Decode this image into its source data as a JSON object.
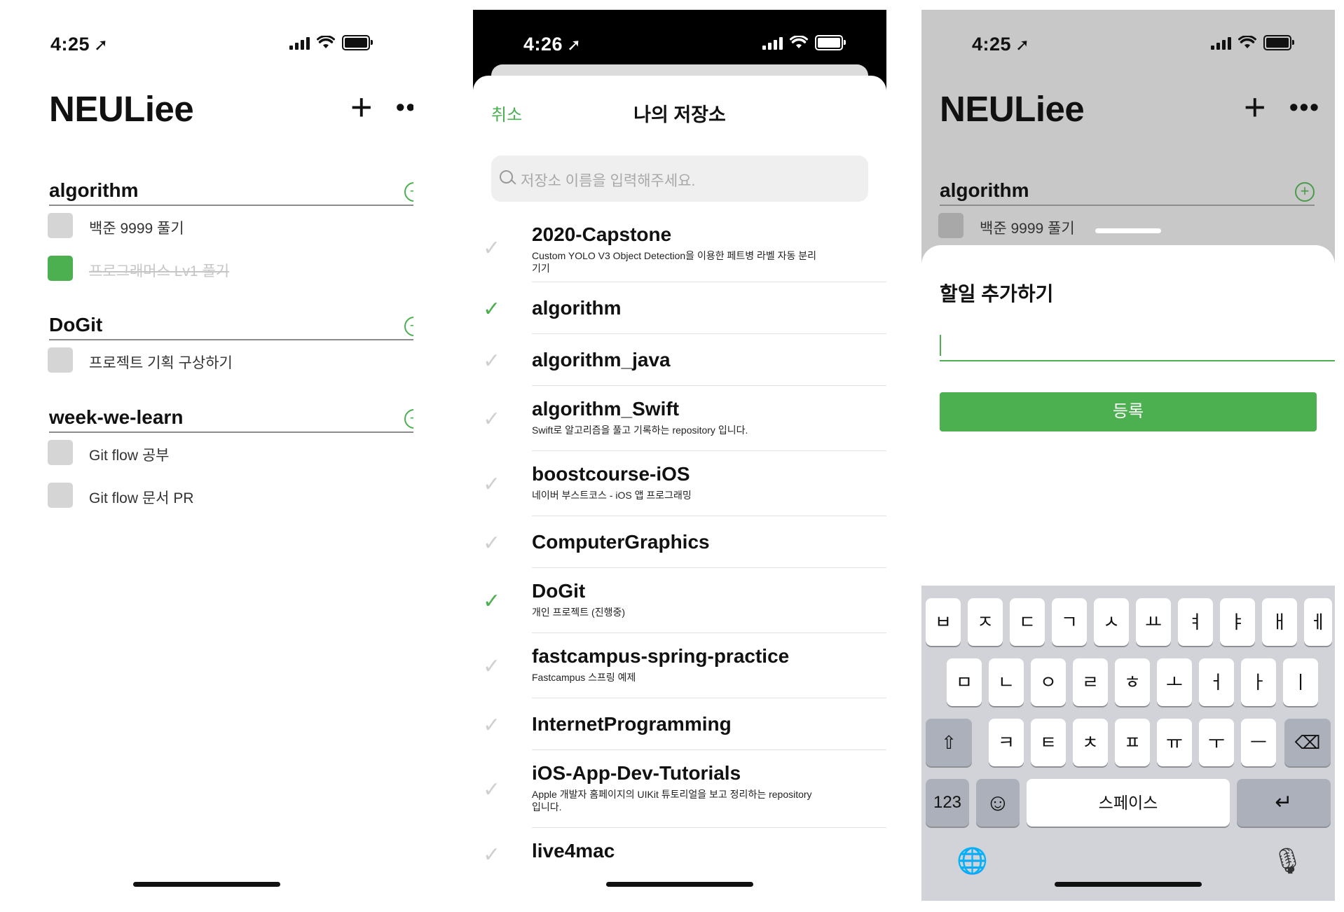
{
  "screen1": {
    "status": {
      "time": "4:25",
      "location_glyph": "➚"
    },
    "title": "NEULiee",
    "plus_label": "+",
    "more_label": "•••",
    "sections": [
      {
        "title": "algorithm",
        "todos": [
          {
            "text": "백준 9999 풀기",
            "done": false
          },
          {
            "text": "프로그래머스 Lv1 풀기",
            "done": true
          }
        ]
      },
      {
        "title": "DoGit",
        "todos": [
          {
            "text": "프로젝트 기획 구상하기",
            "done": false
          }
        ]
      },
      {
        "title": "week-we-learn",
        "todos": [
          {
            "text": "Git flow 공부",
            "done": false
          },
          {
            "text": "Git flow 문서 PR",
            "done": false
          }
        ]
      }
    ]
  },
  "screen2": {
    "status": {
      "time": "4:26",
      "location_glyph": "➚"
    },
    "cancel_label": "취소",
    "title": "나의 저장소",
    "search_placeholder": "저장소 이름을 입력해주세요.",
    "repos": [
      {
        "name": "2020-Capstone",
        "desc": "Custom YOLO V3 Object Detection을 이용한 페트병 라벨 자동 분리기기",
        "checked": false
      },
      {
        "name": "algorithm",
        "desc": "",
        "checked": true
      },
      {
        "name": "algorithm_java",
        "desc": "",
        "checked": false
      },
      {
        "name": "algorithm_Swift",
        "desc": "Swift로 알고리즘을 풀고 기록하는 repository 입니다.",
        "checked": false
      },
      {
        "name": "boostcourse-iOS",
        "desc": "네이버 부스트코스 - iOS 앱 프로그래밍",
        "checked": false
      },
      {
        "name": "ComputerGraphics",
        "desc": "",
        "checked": false
      },
      {
        "name": "DoGit",
        "desc": "개인 프로젝트 (진행중)",
        "checked": true
      },
      {
        "name": "fastcampus-spring-practice",
        "desc": "Fastcampus 스프링 예제",
        "checked": false
      },
      {
        "name": "InternetProgramming",
        "desc": "",
        "checked": false
      },
      {
        "name": "iOS-App-Dev-Tutorials",
        "desc": "Apple 개발자 홈페이지의 UIKit 튜토리얼을 보고 정리하는 repository 입니다.",
        "checked": false
      },
      {
        "name": "live4mac",
        "desc": "",
        "checked": false
      }
    ],
    "check_glyph": "✓"
  },
  "screen3": {
    "status": {
      "time": "4:25",
      "location_glyph": "➚"
    },
    "title": "NEULiee",
    "plus_label": "+",
    "more_label": "•••",
    "section_title": "algorithm",
    "todo_text": "백준 9999 풀기",
    "modal_title": "할일 추가하기",
    "input_value": "",
    "submit_label": "등록",
    "keyboard": {
      "row1": [
        "ㅂ",
        "ㅈ",
        "ㄷ",
        "ㄱ",
        "ㅅ",
        "ㅛ",
        "ㅕ",
        "ㅑ",
        "ㅐ",
        "ㅔ"
      ],
      "row2": [
        "ㅁ",
        "ㄴ",
        "ㅇ",
        "ㄹ",
        "ㅎ",
        "ㅗ",
        "ㅓ",
        "ㅏ",
        "ㅣ"
      ],
      "row3": [
        "ㅋ",
        "ㅌ",
        "ㅊ",
        "ㅍ",
        "ㅠ",
        "ㅜ",
        "ㅡ"
      ],
      "shift_glyph": "⇧",
      "delete_glyph": "⌫",
      "numbers_label": "123",
      "emoji_glyph": "☺",
      "space_label": "스페이스",
      "return_glyph": "↵",
      "globe_glyph": "🌐",
      "mic_glyph": "🎙"
    }
  },
  "colors": {
    "accent": "#4caf50",
    "dim_background": "#c8c8c8",
    "keyboard_background": "#d1d3d9"
  }
}
